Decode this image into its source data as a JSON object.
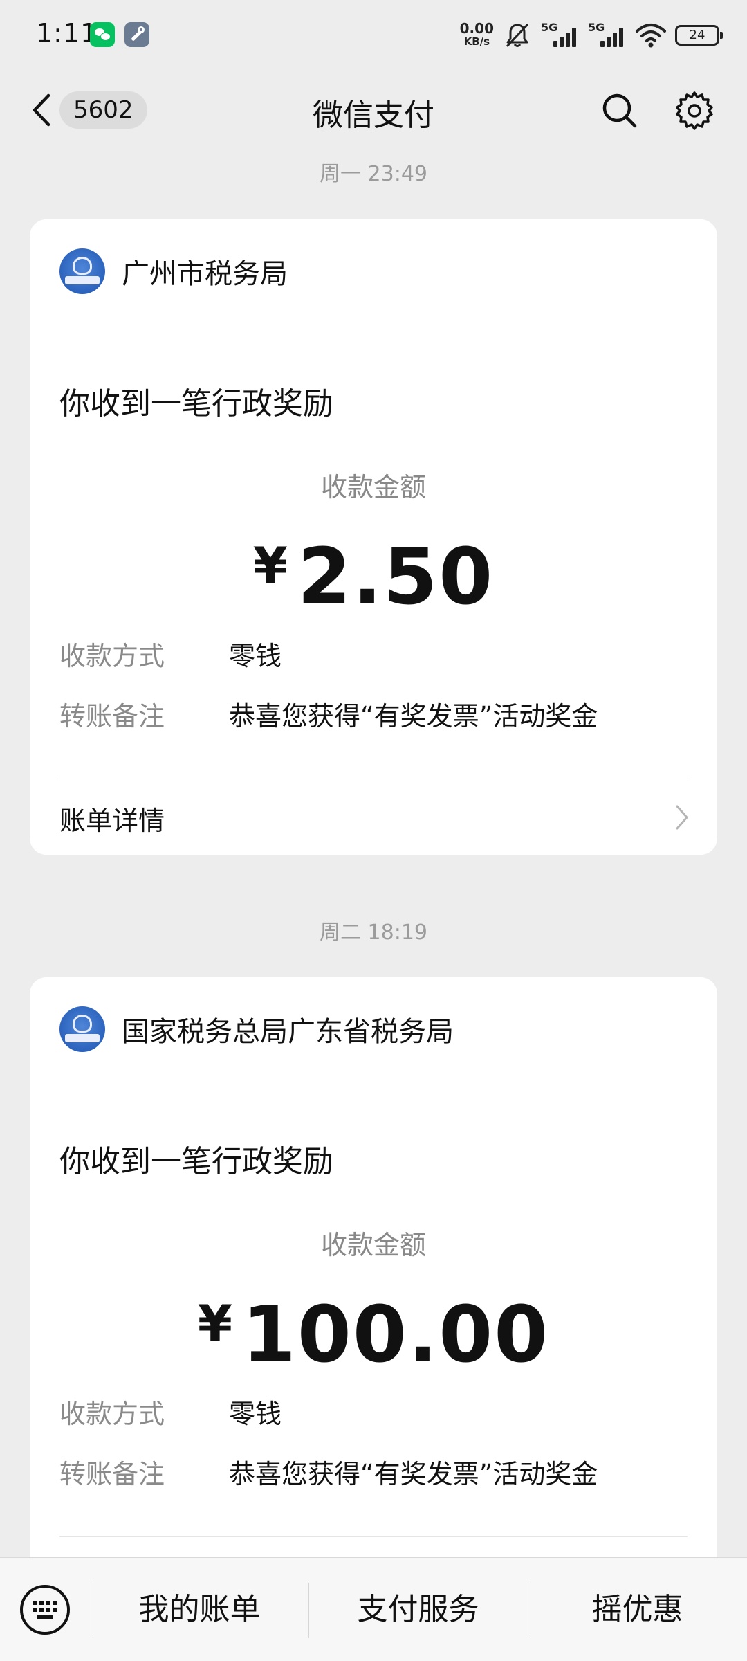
{
  "status_bar": {
    "time": "1:11",
    "net_speed_value": "0.00",
    "net_speed_unit": "KB/s",
    "sim1_label": "5G",
    "sim2_label": "5G",
    "battery": "24"
  },
  "nav": {
    "unread_count": "5602",
    "title": "微信支付"
  },
  "messages": [
    {
      "time": "周一 23:49",
      "org": "广州市税务局",
      "headline": "你收到一笔行政奖励",
      "amount_label": "收款金额",
      "currency": "¥",
      "amount": "2.50",
      "method_label": "收款方式",
      "method_value": "零钱",
      "note_label": "转账备注",
      "note_value": "恭喜您获得“有奖发票”活动奖金",
      "detail_label": "账单详情"
    },
    {
      "time": "周二 18:19",
      "org": "国家税务总局广东省税务局",
      "headline": "你收到一笔行政奖励",
      "amount_label": "收款金额",
      "currency": "¥",
      "amount": "100.00",
      "method_label": "收款方式",
      "method_value": "零钱",
      "note_label": "转账备注",
      "note_value": "恭喜您获得“有奖发票”活动奖金"
    }
  ],
  "bottom_menu": {
    "items": [
      "我的账单",
      "支付服务",
      "摇优惠"
    ]
  },
  "colors": {
    "background": "#ededed",
    "card": "#ffffff",
    "secondary_text": "#8a8a8a",
    "tax_logo_blue": "#2b63bd",
    "wechat_green": "#07c160"
  }
}
